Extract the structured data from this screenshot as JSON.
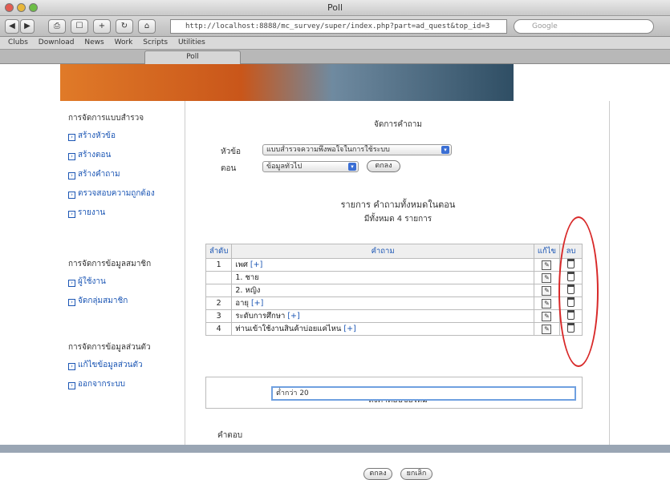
{
  "window": {
    "title": "Poll"
  },
  "toolbar": {
    "url": "http://localhost:8888/mc_survey/super/index.php?part=ad_quest&top_id=3",
    "search_placeholder": "Google"
  },
  "bookmarks": [
    "Clubs",
    "Download",
    "News",
    "Work",
    "Scripts",
    "Utilities"
  ],
  "tabs": [
    "Poll"
  ],
  "sidebar": {
    "section1": "การจัดการแบบสำรวจ",
    "links1": [
      "สร้างหัวข้อ",
      "สร้างตอน",
      "สร้างคำถาม",
      "ตรวจสอบความถูกต้อง",
      "รายงาน"
    ],
    "section2": "การจัดการข้อมูลสมาชิก",
    "links2": [
      "ผู้ใช้งาน",
      "จัดกลุ่มสมาชิก"
    ],
    "section3": "การจัดการข้อมูลส่วนตัว",
    "links3": [
      "แก้ไขข้อมูลส่วนตัว",
      "ออกจากระบบ"
    ]
  },
  "main": {
    "heading": "จัดการคำถาม",
    "topic_label": "หัวข้อ",
    "topic_value": "แบบสำรวจความพึงพอใจในการใช้ระบบ",
    "section_label": "ตอน",
    "section_value": "ข้อมูลทั่วไป",
    "ok_label": "ตกลง",
    "list_title": "รายการ คำถามทั้งหมดในตอน",
    "list_count": "มีทั้งหมด 4 รายการ",
    "table_headers": {
      "no": "ลำดับ",
      "question": "คำถาม",
      "edit": "แก้ไข",
      "delete": "ลบ"
    },
    "rows": [
      {
        "no": "1",
        "question": "เพศ",
        "add": "[+]"
      },
      {
        "no": "",
        "question": "1. ชาย",
        "add": ""
      },
      {
        "no": "",
        "question": "2. หญิง",
        "add": ""
      },
      {
        "no": "2",
        "question": "อายุ",
        "add": "[+]"
      },
      {
        "no": "3",
        "question": "ระดับการศึกษา",
        "add": "[+]"
      },
      {
        "no": "4",
        "question": "ท่านเข้าใช้งานสินค้าบ่อยแค่ไหน",
        "add": "[+]"
      }
    ],
    "new_answer_title": "ตั้งคำตอบข้อใหม่",
    "answer_label": "คำตอบ",
    "answer_value": "ต่ำกว่า 20",
    "submit_label": "ตกลง",
    "cancel_label": "ยกเลิก"
  }
}
